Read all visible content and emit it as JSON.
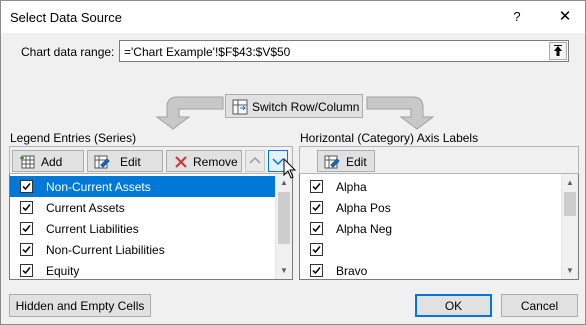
{
  "dialog": {
    "title": "Select Data Source",
    "help_label": "?",
    "close_label": "✕"
  },
  "range": {
    "label": "Chart data range:",
    "value": "='Chart Example'!$F$43:$V$50"
  },
  "switch_button": {
    "label": "Switch Row/Column"
  },
  "legend": {
    "title": "Legend Entries (Series)",
    "add_label": "Add",
    "edit_label": "Edit",
    "remove_label": "Remove",
    "items": [
      {
        "label": "Non-Current Assets",
        "checked": true,
        "selected": true
      },
      {
        "label": "Current Assets",
        "checked": true,
        "selected": false
      },
      {
        "label": "Current Liabilities",
        "checked": true,
        "selected": false
      },
      {
        "label": "Non-Current Liabilities",
        "checked": true,
        "selected": false
      },
      {
        "label": "Equity",
        "checked": true,
        "selected": false
      }
    ]
  },
  "axis": {
    "title": "Horizontal (Category) Axis Labels",
    "edit_label": "Edit",
    "items": [
      {
        "label": "Alpha",
        "checked": true
      },
      {
        "label": "Alpha Pos",
        "checked": true
      },
      {
        "label": "Alpha Neg",
        "checked": true
      },
      {
        "label": "",
        "checked": true
      },
      {
        "label": "Bravo",
        "checked": true
      }
    ]
  },
  "footer": {
    "hidden_cells_label": "Hidden and Empty Cells",
    "ok_label": "OK",
    "cancel_label": "Cancel"
  },
  "colors": {
    "selection": "#0078d7",
    "remove_icon": "#d13438",
    "button_face": "#e1e1e1"
  }
}
